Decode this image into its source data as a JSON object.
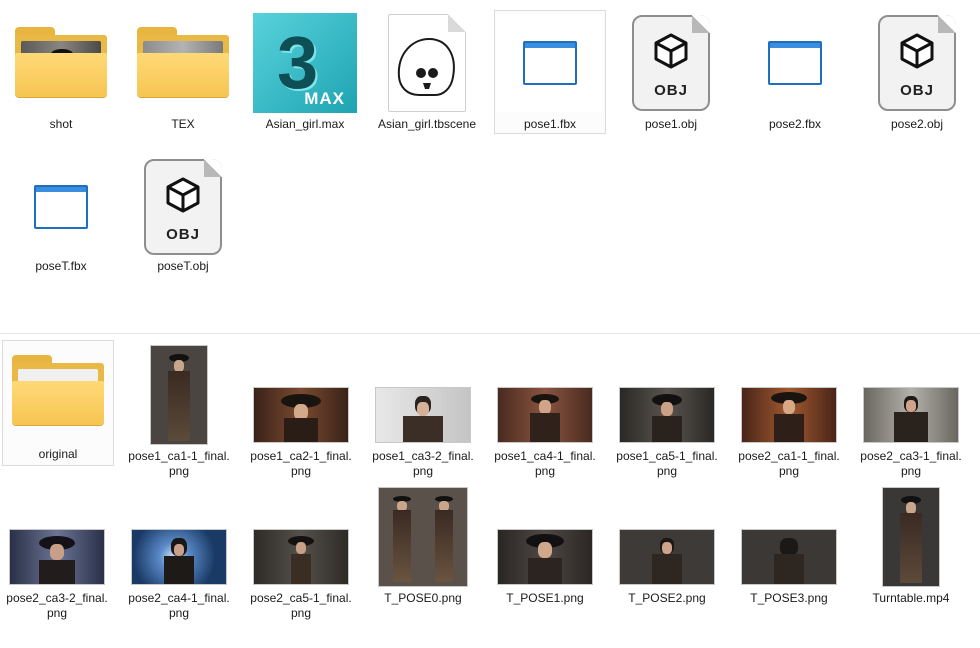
{
  "top_items": [
    {
      "label": "shot",
      "type": "folder-photo"
    },
    {
      "label": "TEX",
      "type": "folder-gray"
    },
    {
      "label": "Asian_girl.max",
      "type": "max",
      "icon_text": "3",
      "icon_word": "MAX"
    },
    {
      "label": "Asian_girl.tbscene",
      "type": "tbscene"
    },
    {
      "label": "pose1.fbx",
      "type": "fbx"
    },
    {
      "label": "pose1.obj",
      "type": "obj",
      "icon_text": "OBJ"
    },
    {
      "label": "pose2.fbx",
      "type": "fbx"
    },
    {
      "label": "pose2.obj",
      "type": "obj",
      "icon_text": "OBJ"
    },
    {
      "label": "poseT.fbx",
      "type": "fbx"
    },
    {
      "label": "poseT.obj",
      "type": "obj",
      "icon_text": "OBJ"
    }
  ],
  "bottom_items": [
    {
      "label": "original",
      "type": "folder-hat"
    },
    {
      "label": "pose1_ca1-1_final.png",
      "type": "render",
      "bg": "#4a4540"
    },
    {
      "label": "pose1_ca2-1_final.png",
      "type": "render",
      "bg": "#5a3526"
    },
    {
      "label": "pose1_ca3-2_final.png",
      "type": "render",
      "bg": "#d2d2d2"
    },
    {
      "label": "pose1_ca4-1_final.png",
      "type": "render",
      "bg": "#6a4234"
    },
    {
      "label": "pose1_ca5-1_final.png",
      "type": "render",
      "bg": "#3e3a36"
    },
    {
      "label": "pose2_ca1-1_final.png",
      "type": "render",
      "bg": "#6d3a22"
    },
    {
      "label": "pose2_ca3-1_final.png",
      "type": "render",
      "bg": "#9a9690"
    },
    {
      "label": "pose2_ca3-2_final.png",
      "type": "render",
      "bg": "#414a66"
    },
    {
      "label": "pose2_ca4-1_final.png",
      "type": "render",
      "bg": "#2f5a8a"
    },
    {
      "label": "pose2_ca5-1_final.png",
      "type": "render",
      "bg": "#3a3632"
    },
    {
      "label": "T_POSE0.png",
      "type": "render",
      "bg": "#5a524a"
    },
    {
      "label": "T_POSE1.png",
      "type": "render",
      "bg": "#3c3632"
    },
    {
      "label": "T_POSE2.png",
      "type": "render",
      "bg": "#3d3a38"
    },
    {
      "label": "T_POSE3.png",
      "type": "render",
      "bg": "#3b3835"
    },
    {
      "label": "Turntable.mp4",
      "type": "render",
      "bg": "#3a3836"
    }
  ]
}
